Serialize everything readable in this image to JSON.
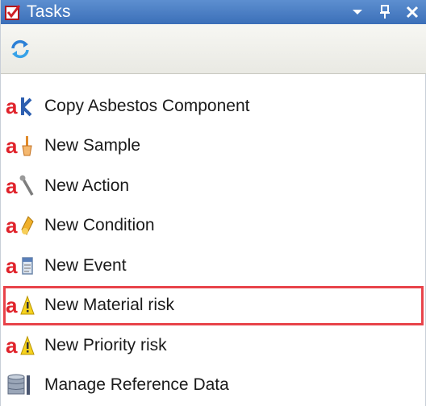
{
  "panel": {
    "title": "Tasks"
  },
  "tasks": [
    {
      "label": "Copy Asbestos Component",
      "icon": "copy-component-icon"
    },
    {
      "label": "New Sample",
      "icon": "sample-icon"
    },
    {
      "label": "New Action",
      "icon": "action-icon"
    },
    {
      "label": "New Condition",
      "icon": "condition-icon"
    },
    {
      "label": "New Event",
      "icon": "event-icon"
    },
    {
      "label": "New Material risk",
      "icon": "material-risk-icon",
      "selected": true
    },
    {
      "label": "New Priority risk",
      "icon": "priority-risk-icon"
    },
    {
      "label": "Manage Reference Data",
      "icon": "database-icon"
    }
  ],
  "colors": {
    "titlebar": "#3b6fb8",
    "selection_outline": "#e8434a",
    "brand_red": "#e0232b"
  }
}
